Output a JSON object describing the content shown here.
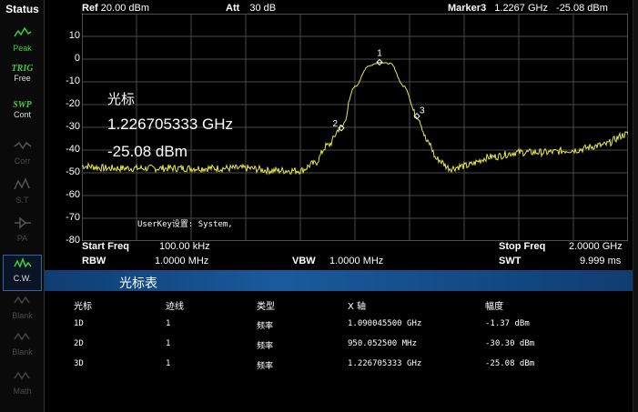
{
  "sidebar": {
    "title": "Status",
    "items": [
      {
        "label": "Peak",
        "icon": "peak-icon",
        "dim": false,
        "strong": false
      },
      {
        "label": "TRIG",
        "sub": "Free",
        "icon": "",
        "dim": false,
        "strong": true
      },
      {
        "label": "SWP",
        "sub": "Cont",
        "icon": "",
        "dim": false,
        "strong": true
      },
      {
        "label": "Corr",
        "icon": "corr-icon",
        "dim": true,
        "strong": false
      },
      {
        "label": "S.T",
        "icon": "st-icon",
        "dim": true,
        "strong": false
      },
      {
        "label": "PA",
        "icon": "pa-icon",
        "dim": true,
        "strong": false
      },
      {
        "label": "C.W.",
        "icon": "cw-icon",
        "dim": false,
        "strong": false,
        "active": true
      },
      {
        "label": "Blank",
        "icon": "blank-icon",
        "dim": true,
        "strong": false
      },
      {
        "label": "Blank",
        "icon": "blank-icon",
        "dim": true,
        "strong": false
      },
      {
        "label": "Math",
        "icon": "math-icon",
        "dim": true,
        "strong": false
      }
    ]
  },
  "header": {
    "ref_label": "Ref",
    "ref_value": "20.00 dBm",
    "att_label": "Att",
    "att_value": "30 dB",
    "marker_label": "Marker3",
    "marker_freq": "1.2267 GHz",
    "marker_level": "-25.08 dBm"
  },
  "overlay": {
    "title": "光标",
    "freq": "1.226705333 GHz",
    "level": "-25.08 dBm",
    "userkey": "UserKey设置:  System,"
  },
  "params": {
    "start_label": "Start Freq",
    "start_value": "100.00 kHz",
    "stop_label": "Stop Freq",
    "stop_value": "2.0000 GHz",
    "rbw_label": "RBW",
    "rbw_value": "1.0000 MHz",
    "vbw_label": "VBW",
    "vbw_value": "1.0000 MHz",
    "swt_label": "SWT",
    "swt_value": "9.999 ms"
  },
  "marker_table": {
    "title": "光标表",
    "headers": [
      "光标",
      "迹线",
      "类型",
      "X 轴",
      "幅度"
    ],
    "rows": [
      [
        "1D",
        "1",
        "频率",
        "1.090045500 GHz",
        "-1.37 dBm"
      ],
      [
        "2D",
        "1",
        "频率",
        "950.052500 MHz",
        "-30.30 dBm"
      ],
      [
        "3D",
        "1",
        "频率",
        "1.226705333 GHz",
        "-25.08 dBm"
      ]
    ]
  },
  "chart_data": {
    "type": "line",
    "xlim": [
      0.0001,
      2.0
    ],
    "x_unit": "GHz",
    "ylim": [
      -80,
      20
    ],
    "ylabel": "",
    "xlabel": "",
    "y_ticks": [
      "10",
      "0",
      "-10",
      "-20",
      "-30",
      "-40",
      "-50",
      "-60",
      "-70",
      "-80"
    ],
    "grid": true,
    "trace_color": "#e8e84a",
    "series": [
      {
        "x": [
          0.0001,
          0.1,
          0.2,
          0.3,
          0.4,
          0.5,
          0.6,
          0.7,
          0.8,
          0.85,
          0.9,
          0.95,
          1.0,
          1.05,
          1.09,
          1.13,
          1.18,
          1.2267,
          1.27,
          1.3,
          1.35,
          1.4,
          1.5,
          1.6,
          1.7,
          1.8,
          1.9,
          2.0
        ],
        "y": [
          -47,
          -48,
          -48,
          -48,
          -48,
          -48,
          -48,
          -49,
          -49,
          -46,
          -38,
          -30,
          -12,
          -3,
          -1.4,
          -2,
          -12,
          -25,
          -37,
          -44,
          -48,
          -47,
          -43,
          -41,
          -41,
          -40,
          -38,
          -33
        ]
      }
    ],
    "markers": [
      {
        "label": "1",
        "x": 1.0900455,
        "y": -1.37
      },
      {
        "label": "2",
        "x": 0.9500525,
        "y": -30.3
      },
      {
        "label": "3",
        "x": 1.226705333,
        "y": -25.08
      }
    ]
  }
}
